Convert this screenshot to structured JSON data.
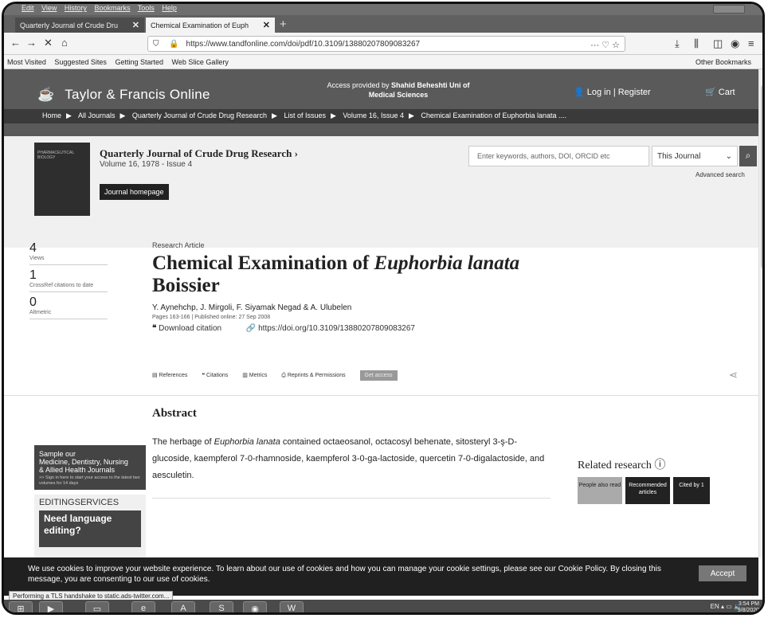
{
  "browser": {
    "menu": [
      "Edit",
      "View",
      "History",
      "Bookmarks",
      "Tools",
      "Help"
    ],
    "tabs": [
      {
        "label": "Quarterly Journal of Crude Dru"
      },
      {
        "label": "Chemical Examination of Euph"
      }
    ],
    "url": "https://www.tandfonline.com/doi/pdf/10.3109/13880207809083267",
    "bookmarks": [
      "Most Visited",
      "Suggested Sites",
      "Getting Started",
      "Web Slice Gallery"
    ],
    "other_bookmarks": "Other Bookmarks",
    "status_text": "Performing a TLS handshake to static.ads-twitter.com..."
  },
  "site": {
    "logo": "Taylor & Francis Online",
    "access_line1": "Access provided by",
    "access_line2": "Shahid Beheshti Uni of Medical Sciences",
    "login": "Log in",
    "register": "Register",
    "cart": "Cart",
    "breadcrumbs": [
      "Home",
      "All Journals",
      "Quarterly Journal of Crude Drug Research",
      "List of Issues",
      "Volume 16, Issue 4",
      "Chemical Examination of Euphorbia lanata ...."
    ]
  },
  "journal": {
    "cover_text": "PHARMACEUTICAL BIOLOGY",
    "title": "Quarterly Journal of Crude Drug Research",
    "subtitle": "Volume 16, 1978 - Issue 4",
    "homepage": "Journal homepage",
    "search_placeholder": "Enter keywords, authors, DOI, ORCID etc",
    "scope": "This Journal",
    "advanced": "Advanced search"
  },
  "metrics": [
    {
      "num": "4",
      "label": "Views"
    },
    {
      "num": "1",
      "label": "CrossRef citations to date"
    },
    {
      "num": "0",
      "label": "Altmetric"
    }
  ],
  "article": {
    "type": "Research Article",
    "title_a": "Chemical Examination of ",
    "title_b": "Euphorbia lanata",
    "title_c": "Boissier",
    "authors": "Y. Aynehchp, J. Mirgoli, F. Siyamak Negad & A. Ulubelen",
    "pages": "Pages 163-166 | Published online: 27 Sep 2008",
    "download": "Download citation",
    "doi": "https://doi.org/10.3109/13880207809083267",
    "tools": [
      "References",
      "Citations",
      "Metrics",
      "Reprints & Permissions"
    ],
    "get_access": "Get access"
  },
  "abstract": {
    "heading": "Abstract",
    "text_a": "The herbage of ",
    "text_b": "Euphorbia lanata",
    "text_c": " contained octaeosanol, octacosyl behenate, sitosteryl 3-ş-D-glucoside, kaempferol 7-0-rhamnoside, kaempferol 3-0-ga-lactoside, quercetin 7-0-digalactoside, and aesculetin."
  },
  "sidebar": {
    "ad_line1": "Sample our",
    "ad_line2": "Medicine, Dentistry, Nursing",
    "ad_line3": "& Allied Health Journals",
    "ad_small": ">> Sign in here to start your access to the latest two volumes for 14 days",
    "editing": "EDITINGSERVICES",
    "need": "Need language editing?"
  },
  "related": {
    "heading": "Related research",
    "tabs": [
      "People also read",
      "Recommended articles",
      "Cited by 1"
    ]
  },
  "cookie": {
    "text": "We use cookies to improve your website experience. To learn about our use of cookies and how you can manage your cookie settings, please see our Cookie Policy. By closing this message, you are consenting to our use of cookies.",
    "accept": "Accept"
  },
  "taskbar": {
    "lang": "EN",
    "time": "3:54 PM",
    "date": "9/8/2020"
  }
}
